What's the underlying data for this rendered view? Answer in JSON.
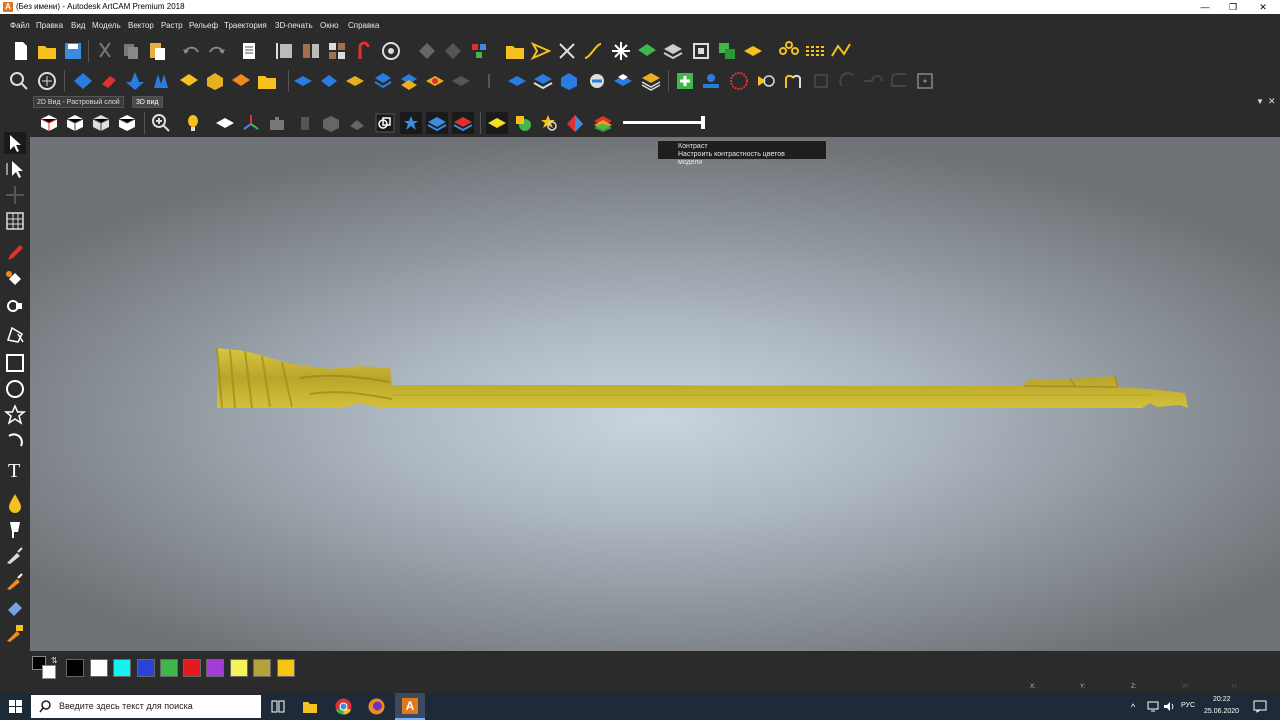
{
  "window": {
    "title": "(Без имени) - Autodesk ArtCAM Premium 2018",
    "app_icon_letter": "A"
  },
  "menu": [
    "Файл",
    "Правка",
    "Вид",
    "Модель",
    "Вектор",
    "Растр",
    "Рельеф",
    "Траектория",
    "3D-печать",
    "Окно",
    "Справка"
  ],
  "tabs": [
    {
      "label": "2D Вид - Растровый слой",
      "active": false
    },
    {
      "label": "3D вид",
      "active": true
    }
  ],
  "tooltip": {
    "title": "Контраст",
    "description": "Настроить контрастность цветов модели"
  },
  "contrast_slider": {
    "value": 1.0
  },
  "palette": {
    "colors": [
      "#000000",
      "#ffffff",
      "#16f0ee",
      "#2a44d8",
      "#3fb84a",
      "#e4191f",
      "#a43bd8",
      "#f5f25a",
      "#b3a43a",
      "#f6c511"
    ]
  },
  "status": {
    "x": "X:",
    "y": "Y:",
    "z": "Z:",
    "w": "W:",
    "h": "H:"
  },
  "taskbar": {
    "search_placeholder": "Введите здесь текст для поиска",
    "language": "РУС",
    "time": "20:22",
    "date": "25.06.2020"
  },
  "model_color": "#c9b531"
}
